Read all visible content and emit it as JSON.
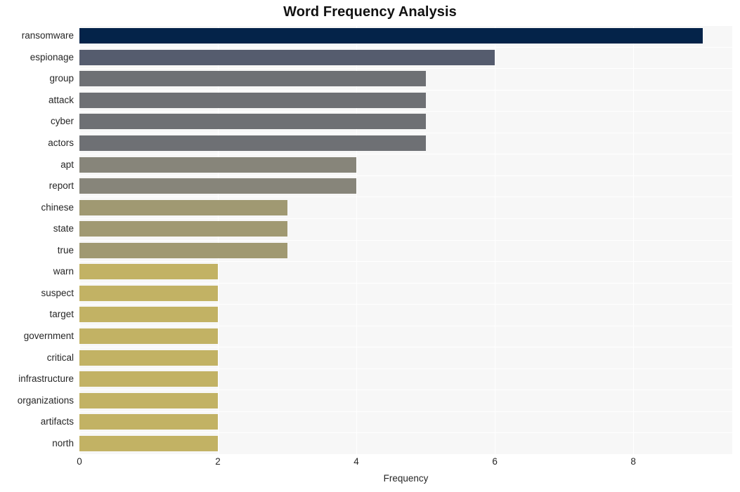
{
  "chart_data": {
    "type": "bar",
    "orientation": "horizontal",
    "title": "Word Frequency Analysis",
    "xlabel": "Frequency",
    "ylabel": "",
    "categories": [
      "ransomware",
      "espionage",
      "group",
      "attack",
      "cyber",
      "actors",
      "apt",
      "report",
      "chinese",
      "state",
      "true",
      "warn",
      "suspect",
      "target",
      "government",
      "critical",
      "infrastructure",
      "organizations",
      "artifacts",
      "north"
    ],
    "values": [
      9,
      6,
      5,
      5,
      5,
      5,
      4,
      4,
      3,
      3,
      3,
      2,
      2,
      2,
      2,
      2,
      2,
      2,
      2,
      2
    ],
    "bar_colors": [
      "#042349",
      "#555c6e",
      "#6e7074",
      "#6e7074",
      "#6e7074",
      "#6e7074",
      "#87857a",
      "#87857a",
      "#a09972",
      "#a09972",
      "#a09972",
      "#c2b264",
      "#c2b264",
      "#c2b264",
      "#c2b264",
      "#c2b264",
      "#c2b264",
      "#c2b264",
      "#c2b264",
      "#c2b264"
    ],
    "xticks": [
      "0",
      "2",
      "4",
      "6",
      "8"
    ],
    "xtick_values": [
      0,
      2,
      4,
      6,
      8
    ],
    "xlim": [
      0,
      9.43
    ],
    "grid": true,
    "grid_color": "#ffffff",
    "plot_background": "#f7f7f7",
    "figure_background": "#ffffff",
    "legend": "none"
  }
}
